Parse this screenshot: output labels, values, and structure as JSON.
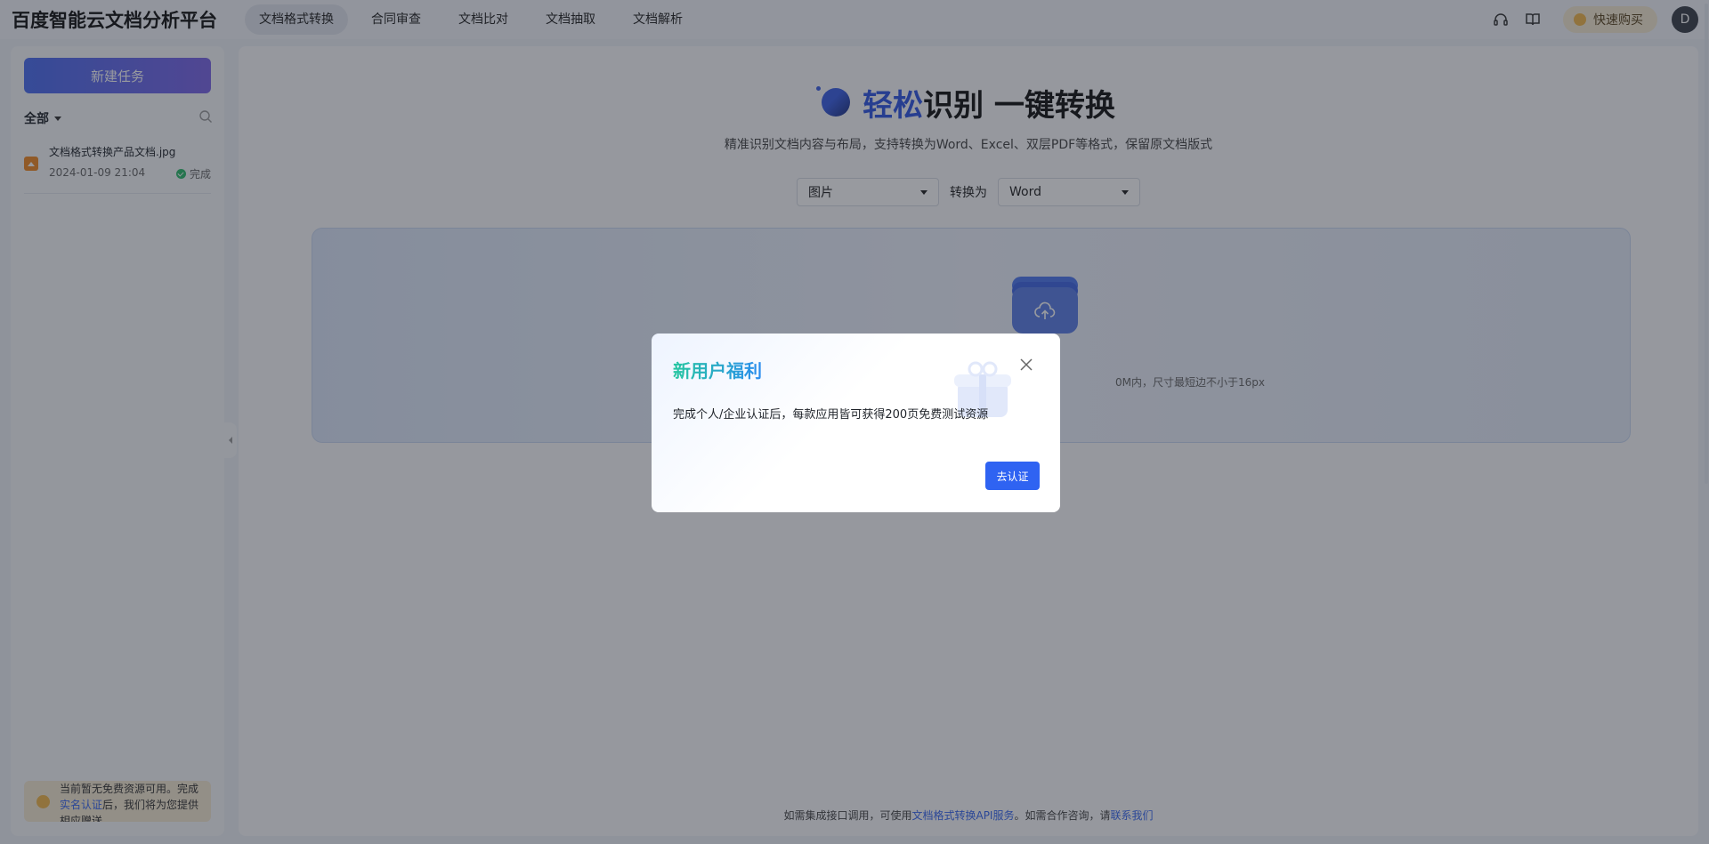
{
  "app": {
    "brand": "百度智能云文档分析平台"
  },
  "nav": {
    "items": [
      {
        "label": "文档格式转换",
        "active": true
      },
      {
        "label": "合同审查",
        "active": false
      },
      {
        "label": "文档比对",
        "active": false
      },
      {
        "label": "文档抽取",
        "active": false
      },
      {
        "label": "文档解析",
        "active": false
      }
    ],
    "buy_label": "快速购买",
    "avatar_initial": "D",
    "icons": [
      "headset-icon",
      "book-icon"
    ]
  },
  "sidebar": {
    "new_task_label": "新建任务",
    "filter_label": "全部",
    "tasks": [
      {
        "name": "文档格式转换产品文档.jpg",
        "time": "2024-01-09 21:04",
        "status": "完成"
      }
    ],
    "notice": {
      "before": "当前暂无免费资源可用。完成",
      "link": "实名认证",
      "after": "后，我们将为您提供相应赠送"
    }
  },
  "main": {
    "title_accent": "轻松",
    "title_rest": "识别 一键转换",
    "subtitle": "精准识别文档内容与布局，支持转换为Word、Excel、双层PDF等格式，保留原文档版式",
    "from_select": "图片",
    "to_label": "转换为",
    "to_select": "Word",
    "upload_hint_visible": "0M内，尺寸最短边不小于16px",
    "footer": {
      "before": "如需集成接口调用，可使用",
      "link1": "文档格式转换API服务",
      "middle": "。如需合作咨询，请",
      "link2": "联系我们"
    }
  },
  "modal": {
    "title": "新用户福利",
    "body": "完成个人/企业认证后，每款应用皆可获得200页免费测试资源",
    "confirm_label": "去认证"
  },
  "colors": {
    "primary": "#2f63f2",
    "title_gradient_start": "#26c6a0",
    "title_gradient_end": "#2b8cf0",
    "success": "#2dbb6b",
    "coin": "#f2b84b"
  }
}
